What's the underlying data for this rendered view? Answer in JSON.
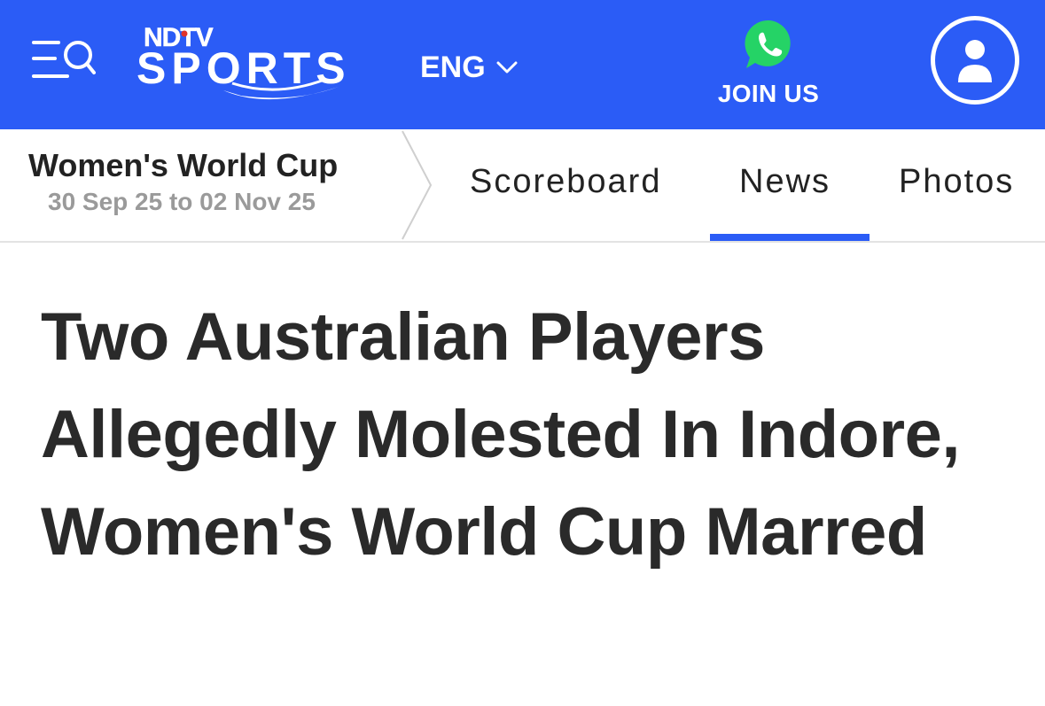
{
  "header": {
    "logo_top": "NDTV",
    "logo_main": "SPORTS",
    "language": "ENG",
    "join_label": "JOIN US",
    "colors": {
      "bar": "#2b5cf6",
      "whatsapp": "#25d366"
    },
    "icons": [
      "menu-search-icon",
      "chevron-down-icon",
      "whatsapp-icon",
      "user-icon"
    ]
  },
  "tournament": {
    "title": "Women's World Cup",
    "dates": "30 Sep 25 to 02 Nov 25"
  },
  "tabs": [
    {
      "label": "Scoreboard",
      "active": false
    },
    {
      "label": "News",
      "active": true
    },
    {
      "label": "Photos",
      "active": false
    }
  ],
  "article": {
    "headline": "Two Australian Players Allegedly Molested In Indore, Women's World Cup Marred"
  }
}
